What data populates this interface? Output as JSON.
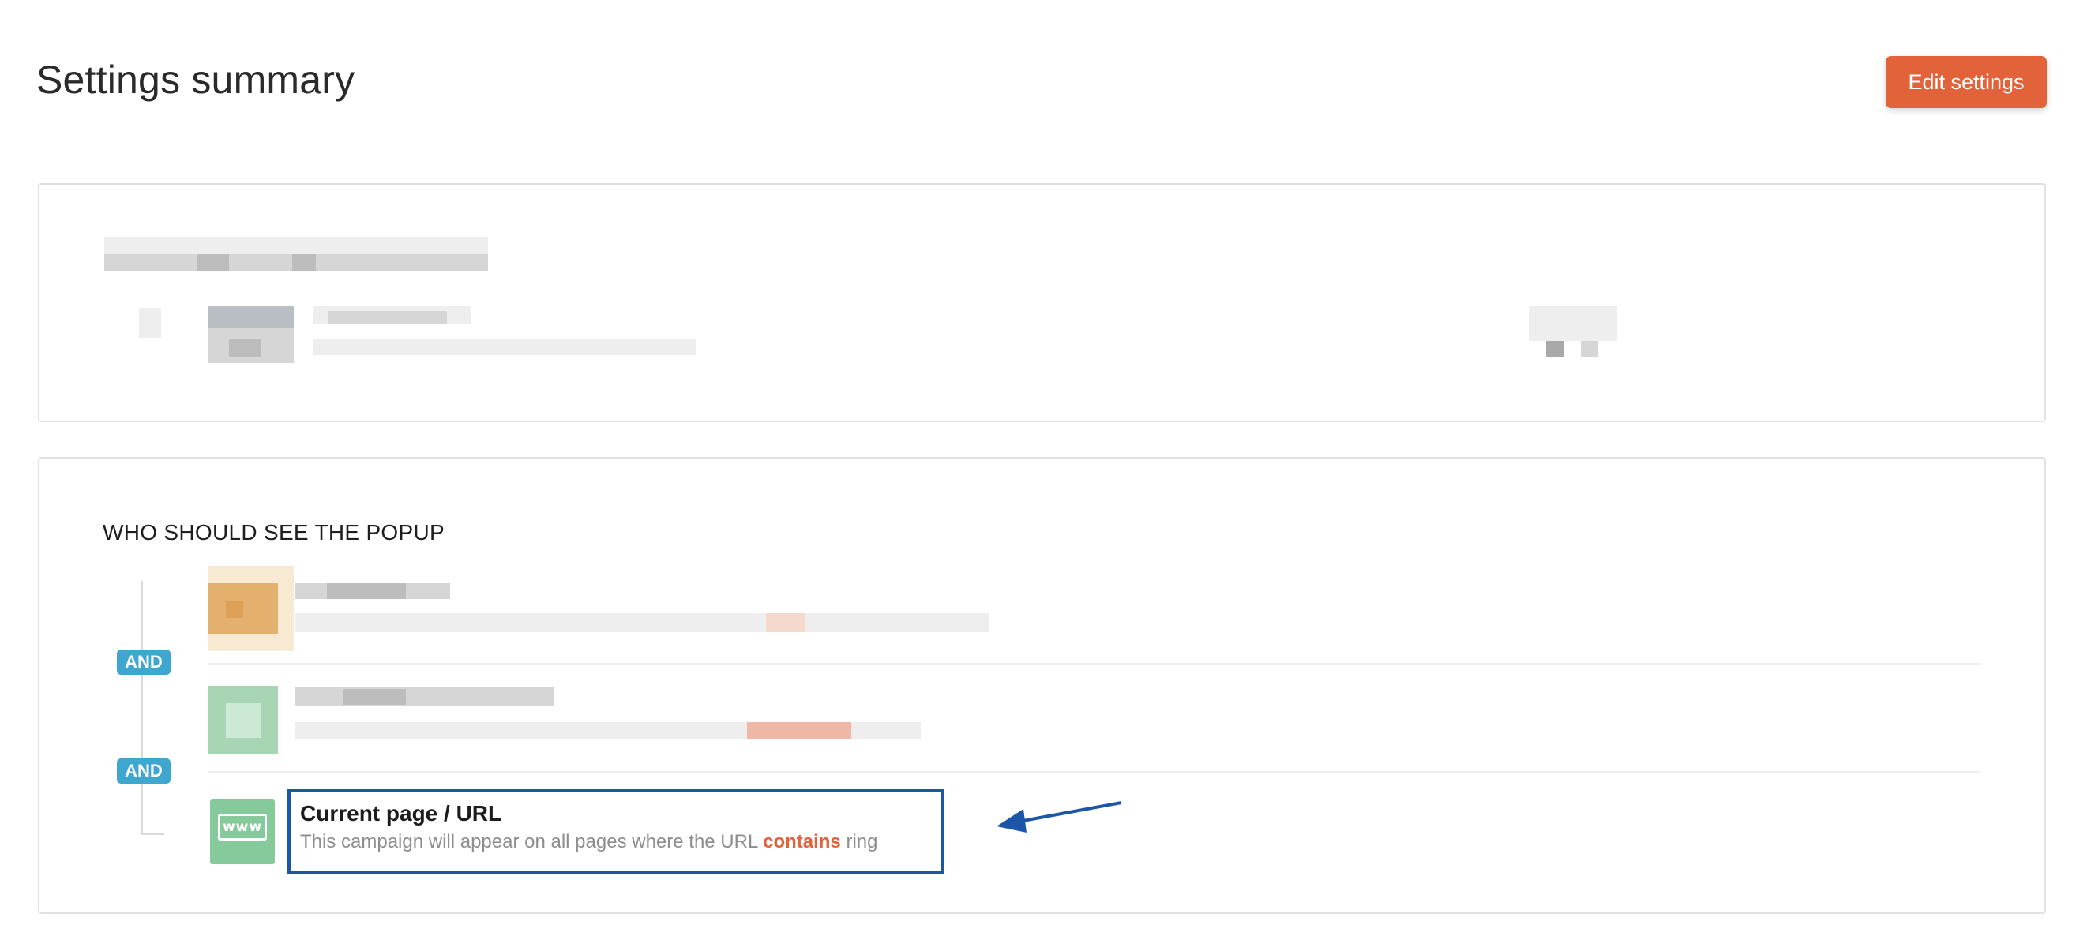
{
  "header": {
    "title": "Settings summary",
    "edit_button_label": "Edit settings"
  },
  "who_section": {
    "heading": "WHO SHOULD SEE THE POPUP",
    "operators": [
      "AND",
      "AND"
    ],
    "conditions": [
      {
        "title": "Current page / URL",
        "description_prefix": "This campaign will appear on all pages where the URL ",
        "keyword": "contains",
        "value": " ring",
        "icon": "www-icon"
      }
    ]
  },
  "colors": {
    "accent": "#e2623a",
    "badge": "#3ea7cf",
    "highlight": "#1b56a8",
    "url_icon": "#86c99a"
  }
}
